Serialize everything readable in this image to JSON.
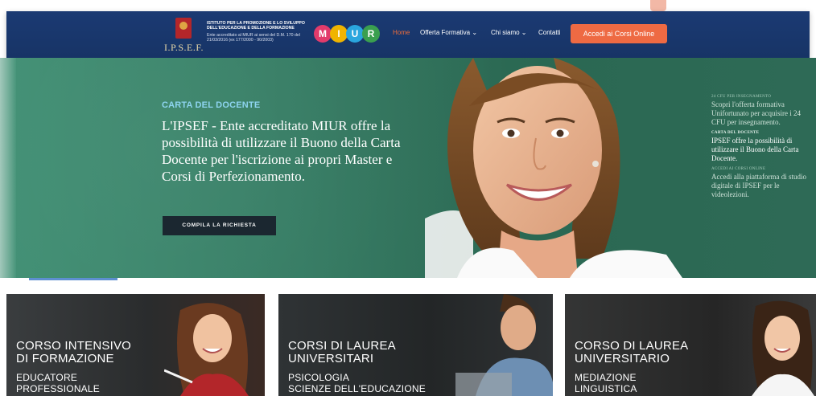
{
  "top_strip": {
    "ghost_text": ""
  },
  "header": {
    "logo_text": "I.P.S.E.F.",
    "institute_name": "ISTITUTO PER LA PROMOZIONE E LO SVILUPPO DELL'EDUCAZIONE E DELLA FORMAZIONE",
    "accreditation": "Ente accreditato al MIUR ai sensi del D.M. 170 del 21/03/2016 (ex 177/2000 - 90/2003)",
    "miur_letters": [
      "M",
      "I",
      "U",
      "R"
    ],
    "nav": {
      "home": "Home",
      "offerta": "Offerta Formativa ⌄",
      "chi_siamo": "Chi siamo ⌄",
      "contatti": "Contatti"
    },
    "cta": "Accedi ai Corsi Online"
  },
  "hero": {
    "overline": "CARTA DEL DOCENTE",
    "headline": "L'IPSEF - Ente accreditato MIUR offre la possibilità di utilizzare il Buono della Carta Docente per l'iscrizione ai propri Master e Corsi di Perfezionamento.",
    "button": "COMPILA LA RICHIESTA"
  },
  "side": {
    "item1_label": "24 CFU PER INSEGNAMENTO",
    "item1_text": "Scopri l'offerta formativa Unifortunato per acquisire i 24 CFU per insegnamento.",
    "item2_label": "CARTA DEL DOCENTE",
    "item2_text": "IPSEF offre la possibilità di utilizzare il Buono della Carta Docente.",
    "item3_label": "ACCEDI AI CORSI ONLINE",
    "item3_text": "Accedi alla piattaforma di studio digitale di IPSEF per le videolezioni."
  },
  "cards": [
    {
      "title1": "CORSO INTENSIVO",
      "title2": "DI FORMAZIONE",
      "sub1": "EDUCATORE",
      "sub2": "PROFESSIONALE"
    },
    {
      "title1": "CORSI DI LAUREA",
      "title2": "UNIVERSITARI",
      "sub1": "PSICOLOGIA",
      "sub2": "SCIENZE DELL'EDUCAZIONE"
    },
    {
      "title1": "CORSO DI LAUREA",
      "title2": "UNIVERSITARIO",
      "sub1": "MEDIAZIONE",
      "sub2": "LINGUISTICA"
    }
  ],
  "colors": {
    "header_bg": "#1b3a73",
    "accent_orange": "#ee6a43",
    "hero_green": "#337b62",
    "overline_blue": "#8ed4f0"
  }
}
